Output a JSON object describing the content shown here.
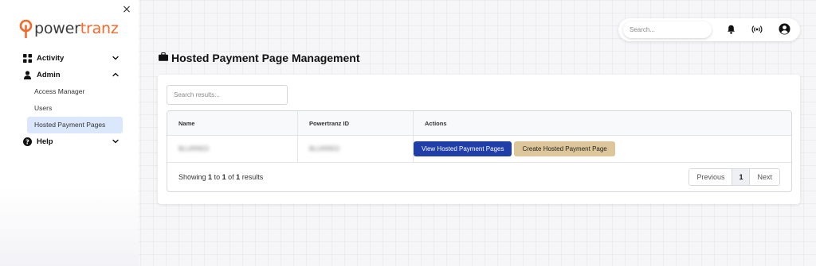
{
  "app": {
    "logo_power": "power",
    "logo_tranz": "tranz",
    "close_symbol": "×"
  },
  "sidebar": {
    "items": [
      {
        "label": "Activity",
        "icon": "grid-icon",
        "expanded": false
      },
      {
        "label": "Admin",
        "icon": "user-icon",
        "expanded": true,
        "children": [
          {
            "label": "Access Manager",
            "active": false
          },
          {
            "label": "Users",
            "active": false
          },
          {
            "label": "Hosted Payment Pages",
            "active": true
          }
        ]
      },
      {
        "label": "Help",
        "icon": "question-circle-icon",
        "expanded": false
      }
    ]
  },
  "topbar": {
    "search_placeholder": "Search...",
    "icons": [
      "bell-icon",
      "broadcast-icon",
      "account-circle-icon"
    ]
  },
  "page": {
    "title": "Hosted Payment Page Management",
    "title_icon": "briefcase-icon"
  },
  "table": {
    "search_placeholder": "Search results...",
    "headers": [
      "Name",
      "Powertranz ID",
      "Actions"
    ],
    "rows": [
      {
        "name": "BLURRED",
        "powertranz_id": "BLURRED",
        "action_view": "View Hosted Payment Pages",
        "action_create": "Create Hosted Payment Page"
      }
    ],
    "footer": {
      "showing_prefix": "Showing",
      "from": "1",
      "to_word": "to",
      "to": "1",
      "of_word": "of",
      "total": "1",
      "results_word": "results"
    },
    "pagination": {
      "previous": "Previous",
      "current": "1",
      "next": "Next"
    }
  },
  "colors": {
    "brand_orange": "#f06a2a",
    "primary_button": "#1f3ea8",
    "secondary_button": "#ddc79a",
    "active_nav_bg": "#dbe8fb"
  }
}
